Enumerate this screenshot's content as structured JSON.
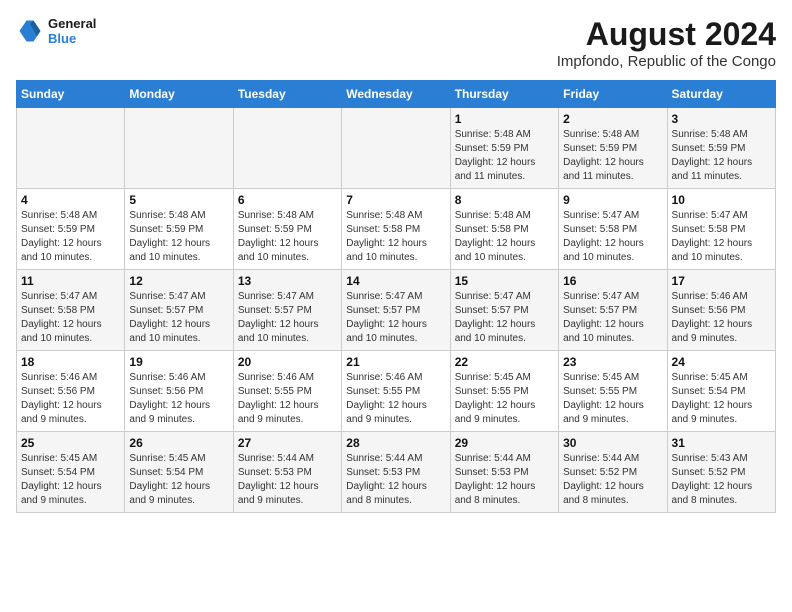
{
  "header": {
    "logo": {
      "line1": "General",
      "line2": "Blue"
    },
    "title": "August 2024",
    "subtitle": "Impfondo, Republic of the Congo"
  },
  "calendar": {
    "days_of_week": [
      "Sunday",
      "Monday",
      "Tuesday",
      "Wednesday",
      "Thursday",
      "Friday",
      "Saturday"
    ],
    "weeks": [
      [
        {
          "day": "",
          "info": ""
        },
        {
          "day": "",
          "info": ""
        },
        {
          "day": "",
          "info": ""
        },
        {
          "day": "",
          "info": ""
        },
        {
          "day": "1",
          "info": "Sunrise: 5:48 AM\nSunset: 5:59 PM\nDaylight: 12 hours and 11 minutes."
        },
        {
          "day": "2",
          "info": "Sunrise: 5:48 AM\nSunset: 5:59 PM\nDaylight: 12 hours and 11 minutes."
        },
        {
          "day": "3",
          "info": "Sunrise: 5:48 AM\nSunset: 5:59 PM\nDaylight: 12 hours and 11 minutes."
        }
      ],
      [
        {
          "day": "4",
          "info": "Sunrise: 5:48 AM\nSunset: 5:59 PM\nDaylight: 12 hours and 10 minutes."
        },
        {
          "day": "5",
          "info": "Sunrise: 5:48 AM\nSunset: 5:59 PM\nDaylight: 12 hours and 10 minutes."
        },
        {
          "day": "6",
          "info": "Sunrise: 5:48 AM\nSunset: 5:59 PM\nDaylight: 12 hours and 10 minutes."
        },
        {
          "day": "7",
          "info": "Sunrise: 5:48 AM\nSunset: 5:58 PM\nDaylight: 12 hours and 10 minutes."
        },
        {
          "day": "8",
          "info": "Sunrise: 5:48 AM\nSunset: 5:58 PM\nDaylight: 12 hours and 10 minutes."
        },
        {
          "day": "9",
          "info": "Sunrise: 5:47 AM\nSunset: 5:58 PM\nDaylight: 12 hours and 10 minutes."
        },
        {
          "day": "10",
          "info": "Sunrise: 5:47 AM\nSunset: 5:58 PM\nDaylight: 12 hours and 10 minutes."
        }
      ],
      [
        {
          "day": "11",
          "info": "Sunrise: 5:47 AM\nSunset: 5:58 PM\nDaylight: 12 hours and 10 minutes."
        },
        {
          "day": "12",
          "info": "Sunrise: 5:47 AM\nSunset: 5:57 PM\nDaylight: 12 hours and 10 minutes."
        },
        {
          "day": "13",
          "info": "Sunrise: 5:47 AM\nSunset: 5:57 PM\nDaylight: 12 hours and 10 minutes."
        },
        {
          "day": "14",
          "info": "Sunrise: 5:47 AM\nSunset: 5:57 PM\nDaylight: 12 hours and 10 minutes."
        },
        {
          "day": "15",
          "info": "Sunrise: 5:47 AM\nSunset: 5:57 PM\nDaylight: 12 hours and 10 minutes."
        },
        {
          "day": "16",
          "info": "Sunrise: 5:47 AM\nSunset: 5:57 PM\nDaylight: 12 hours and 10 minutes."
        },
        {
          "day": "17",
          "info": "Sunrise: 5:46 AM\nSunset: 5:56 PM\nDaylight: 12 hours and 9 minutes."
        }
      ],
      [
        {
          "day": "18",
          "info": "Sunrise: 5:46 AM\nSunset: 5:56 PM\nDaylight: 12 hours and 9 minutes."
        },
        {
          "day": "19",
          "info": "Sunrise: 5:46 AM\nSunset: 5:56 PM\nDaylight: 12 hours and 9 minutes."
        },
        {
          "day": "20",
          "info": "Sunrise: 5:46 AM\nSunset: 5:55 PM\nDaylight: 12 hours and 9 minutes."
        },
        {
          "day": "21",
          "info": "Sunrise: 5:46 AM\nSunset: 5:55 PM\nDaylight: 12 hours and 9 minutes."
        },
        {
          "day": "22",
          "info": "Sunrise: 5:45 AM\nSunset: 5:55 PM\nDaylight: 12 hours and 9 minutes."
        },
        {
          "day": "23",
          "info": "Sunrise: 5:45 AM\nSunset: 5:55 PM\nDaylight: 12 hours and 9 minutes."
        },
        {
          "day": "24",
          "info": "Sunrise: 5:45 AM\nSunset: 5:54 PM\nDaylight: 12 hours and 9 minutes."
        }
      ],
      [
        {
          "day": "25",
          "info": "Sunrise: 5:45 AM\nSunset: 5:54 PM\nDaylight: 12 hours and 9 minutes."
        },
        {
          "day": "26",
          "info": "Sunrise: 5:45 AM\nSunset: 5:54 PM\nDaylight: 12 hours and 9 minutes."
        },
        {
          "day": "27",
          "info": "Sunrise: 5:44 AM\nSunset: 5:53 PM\nDaylight: 12 hours and 9 minutes."
        },
        {
          "day": "28",
          "info": "Sunrise: 5:44 AM\nSunset: 5:53 PM\nDaylight: 12 hours and 8 minutes."
        },
        {
          "day": "29",
          "info": "Sunrise: 5:44 AM\nSunset: 5:53 PM\nDaylight: 12 hours and 8 minutes."
        },
        {
          "day": "30",
          "info": "Sunrise: 5:44 AM\nSunset: 5:52 PM\nDaylight: 12 hours and 8 minutes."
        },
        {
          "day": "31",
          "info": "Sunrise: 5:43 AM\nSunset: 5:52 PM\nDaylight: 12 hours and 8 minutes."
        }
      ]
    ]
  }
}
